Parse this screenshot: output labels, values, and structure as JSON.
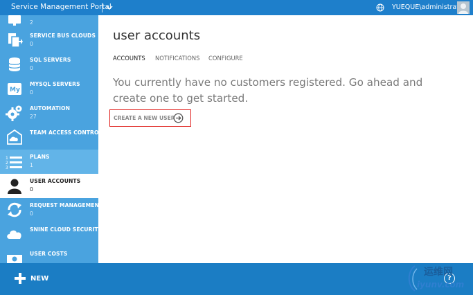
{
  "topbar": {
    "title": "Service Management Portal",
    "user": "YUEQUE\\administrator"
  },
  "sidebar": {
    "items": [
      {
        "label": "",
        "count": "2"
      },
      {
        "label": "SERVICE BUS CLOUDS",
        "count": "0"
      },
      {
        "label": "SQL SERVERS",
        "count": "0"
      },
      {
        "label": "MYSQL SERVERS",
        "count": "0"
      },
      {
        "label": "AUTOMATION",
        "count": "27"
      },
      {
        "label": "TEAM ACCESS CONTROL",
        "count": ""
      },
      {
        "label": "PLANS",
        "count": "1"
      },
      {
        "label": "USER ACCOUNTS",
        "count": "0"
      },
      {
        "label": "REQUEST MANAGEMENT",
        "count": "0"
      },
      {
        "label": "SNINE CLOUD SECURITY",
        "count": ""
      },
      {
        "label": "USER COSTS",
        "count": ""
      }
    ]
  },
  "main": {
    "title": "user accounts",
    "tabs": [
      "ACCOUNTS",
      "NOTIFICATIONS",
      "CONFIGURE"
    ],
    "empty_message": "You currently have no customers registered. Go ahead and create one to get started.",
    "create_link": "CREATE A NEW USER"
  },
  "bottombar": {
    "new_label": "NEW",
    "help_label": "?"
  },
  "watermark": {
    "cn": "运维网",
    "en": "iyunv.com"
  },
  "colors": {
    "topbar": "#1e7fcb",
    "sidebar": "#4aa3df",
    "sidebar_highlight": "#62b4e8",
    "bottombar": "#1b7dc4",
    "highlight_border": "#e0201d"
  }
}
